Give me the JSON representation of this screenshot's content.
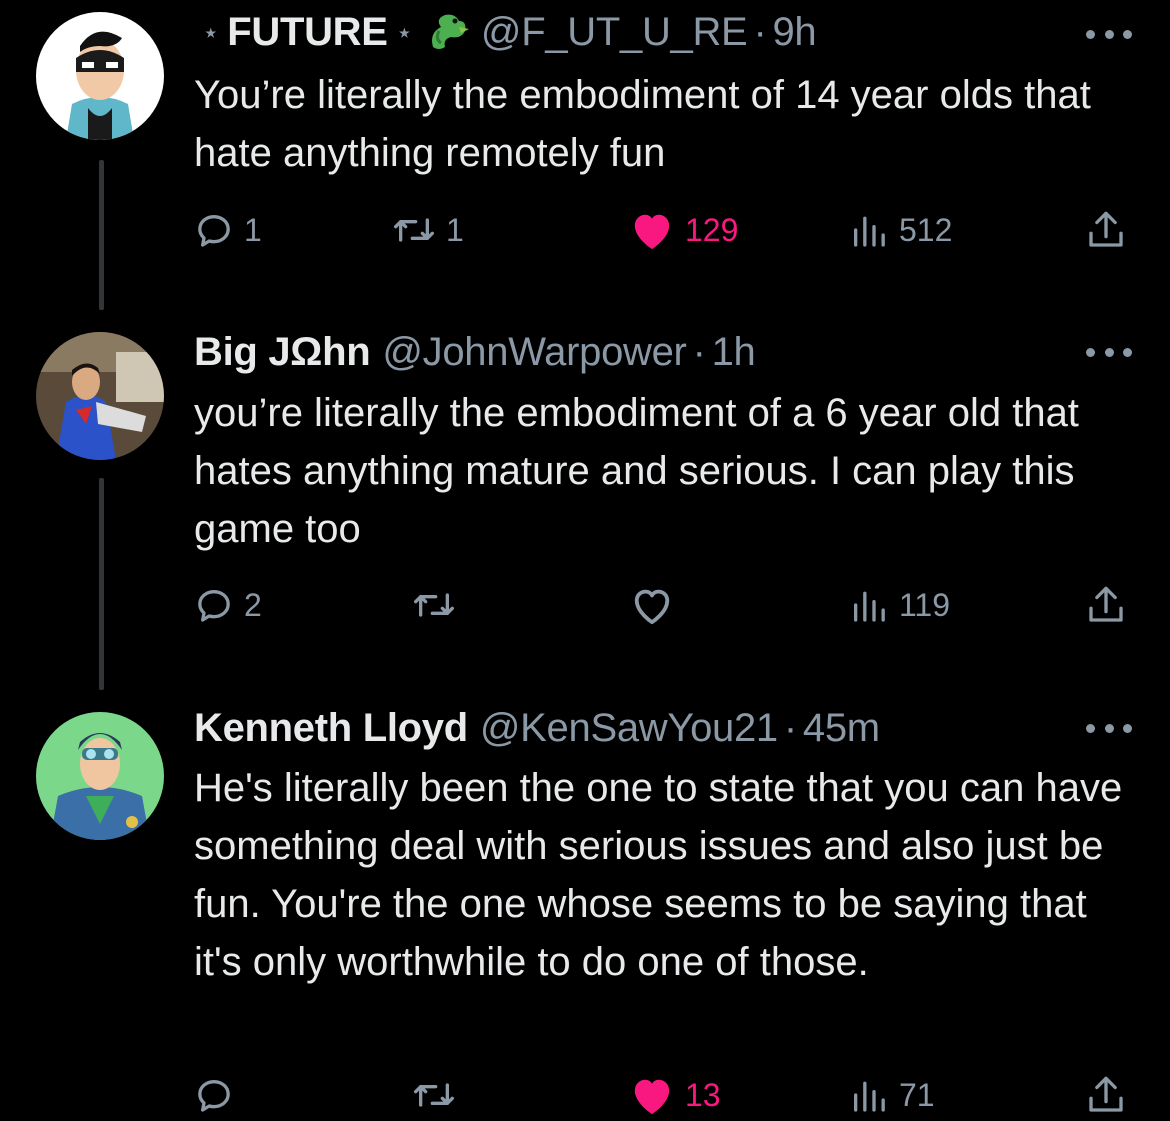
{
  "tweets": [
    {
      "name": "FUTURE",
      "deco_left": "⋆",
      "deco_right": "⋆",
      "badge": "dragon-emoji",
      "handle": "@F_UT_U_RE",
      "time": "9h",
      "text": "You’re literally the embodiment of 14 year olds that hate anything remotely fun",
      "replies": "1",
      "retweets": "1",
      "likes": "129",
      "liked": true,
      "views": "512"
    },
    {
      "name": "Big JΩhn",
      "handle": "@JohnWarpower",
      "time": "1h",
      "text": "you’re literally the embodiment of a 6 year old that hates anything mature and serious. I can play this game too",
      "replies": "2",
      "retweets": "",
      "likes": "",
      "liked": false,
      "views": "119"
    },
    {
      "name": "Kenneth Lloyd",
      "handle": "@KenSawYou21",
      "time": "45m",
      "text": "He's literally been the one to state that you can have something deal with serious issues and also just be fun. You're the one whose seems to be saying that it's only worthwhile to do one of those.",
      "replies": "",
      "retweets": "",
      "likes": "13",
      "liked": true,
      "views": "71"
    }
  ],
  "separator": "·",
  "colors": {
    "background": "#000000",
    "text": "#e7e9ea",
    "muted": "#8b98a5",
    "like": "#f91880",
    "thread_line": "#333639"
  },
  "icons": {
    "reply": "reply-icon",
    "retweet": "retweet-icon",
    "like": "heart-icon",
    "views": "views-icon",
    "share": "share-icon",
    "more": "more-icon"
  }
}
